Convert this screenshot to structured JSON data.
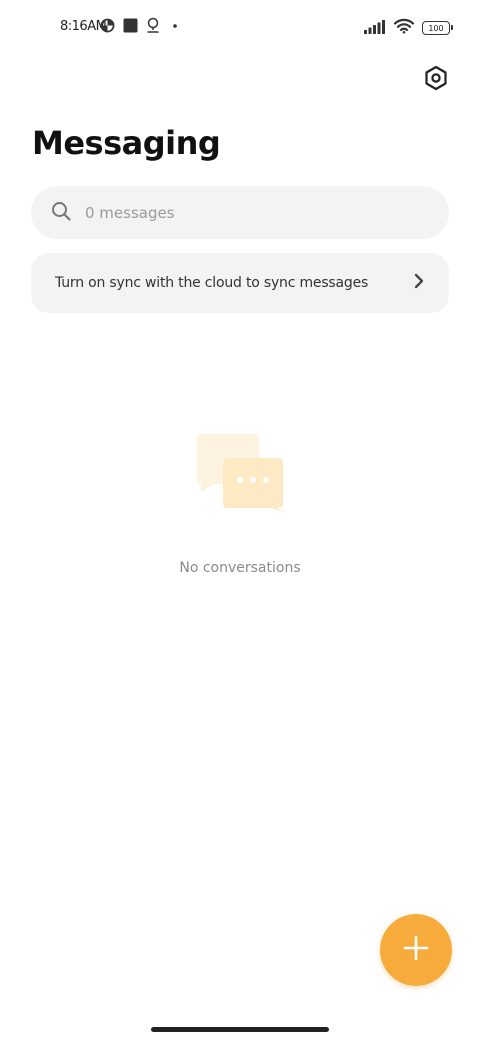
{
  "status_bar": {
    "time": "8:16AM",
    "battery": "100",
    "icons": [
      "data-saver-icon",
      "square-notification-icon",
      "location-icon",
      "dot-icon",
      "signal-icon",
      "wifi-icon",
      "battery-icon"
    ]
  },
  "header": {
    "title": "Messaging",
    "settings_icon": "settings-icon"
  },
  "search": {
    "placeholder": "0 messages",
    "value": ""
  },
  "sync_banner": {
    "label": "Turn on sync with the cloud to sync messages"
  },
  "empty_state": {
    "label": "No conversations",
    "icon": "chat-bubbles-icon"
  },
  "fab": {
    "icon": "plus-icon"
  },
  "colors": {
    "accent": "#f6ab3c",
    "surface": "#f3f3f3",
    "illustration_back": "#fdf3e0",
    "illustration_front": "#fde9c4"
  }
}
